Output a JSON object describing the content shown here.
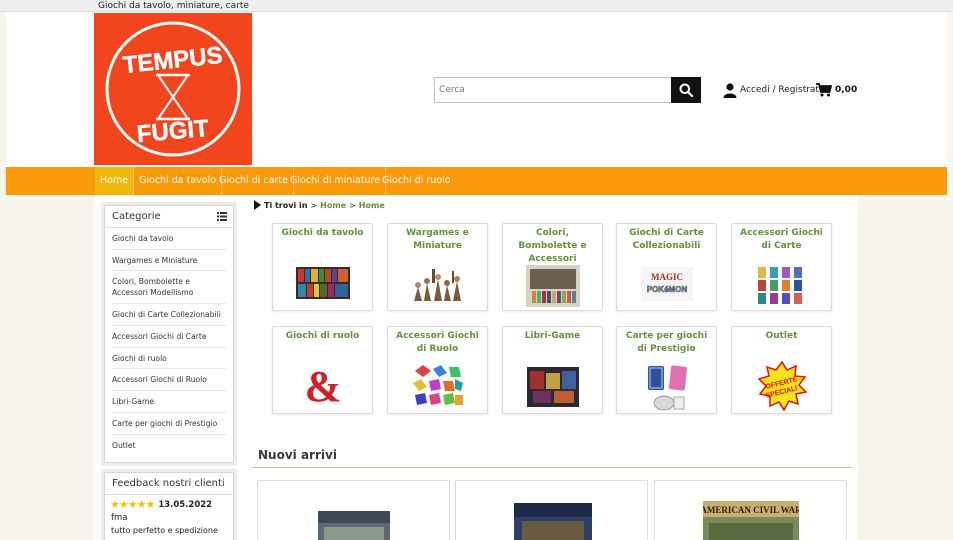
{
  "topbar": {
    "tagline": "Giochi da tavolo, miniature, carte"
  },
  "logo": {
    "line1": "TEMPUS",
    "line2": "FUGIT",
    "color": "#f2441d"
  },
  "search": {
    "placeholder": "Cerca"
  },
  "account": {
    "label": "Accedi / Registrati"
  },
  "cart": {
    "total": "0,00"
  },
  "nav": {
    "items": [
      {
        "label": "Home"
      },
      {
        "label": "Giochi da tavolo"
      },
      {
        "label": "Giochi di carte"
      },
      {
        "label": "Giochi di miniature"
      },
      {
        "label": "Giochi di ruolo"
      }
    ]
  },
  "sidebar": {
    "title": "Categorie",
    "items": [
      {
        "label": "Giochi da tavolo"
      },
      {
        "label": "Wargames e Miniature"
      },
      {
        "label": "Colori, Bombolette e Accessori Modellismo"
      },
      {
        "label": "Giochi di Carte Collezionabili"
      },
      {
        "label": "Accessori Giochi di Carte"
      },
      {
        "label": "Giochi di ruolo"
      },
      {
        "label": "Accessori Giochi di Ruolo"
      },
      {
        "label": "Libri-Game"
      },
      {
        "label": "Carte per giochi di Prestigio"
      },
      {
        "label": "Outlet"
      }
    ]
  },
  "feedback": {
    "title": "Feedback nostri clienti",
    "stars": "★★★★★",
    "date": "13.05.2022",
    "user": "fma",
    "text": "tutto perfetto e spedizione"
  },
  "breadcrumb": {
    "prefix": "Ti trovi in",
    "sep": ">",
    "items": [
      "Home",
      "Home"
    ]
  },
  "categories": [
    {
      "title": "Giochi da tavolo"
    },
    {
      "title": "Wargames e Miniature"
    },
    {
      "title": "Colori, Bombolette e Accessori"
    },
    {
      "title": "Giochi di Carte Collezionabili"
    },
    {
      "title": "Accessori Giochi di Carte"
    },
    {
      "title": "Giochi di ruolo"
    },
    {
      "title": "Accessori Giochi di Ruolo"
    },
    {
      "title": "Libri-Game"
    },
    {
      "title": "Carte per giochi di Prestigio"
    },
    {
      "title": "Outlet"
    }
  ],
  "outlet_badge": {
    "line1": "OFFERTE",
    "line2": "SPECIALI"
  },
  "magic_badge": {
    "line1": "MAGIC",
    "line2": "POKéMON"
  },
  "new_arrivals": {
    "title": "Nuovi arrivi",
    "product3_caption": "AMERICAN CIVIL WAR"
  },
  "colors": {
    "nav": "#fa9a0b",
    "nav_active": "#f0b80c",
    "category_title": "#62923a"
  }
}
